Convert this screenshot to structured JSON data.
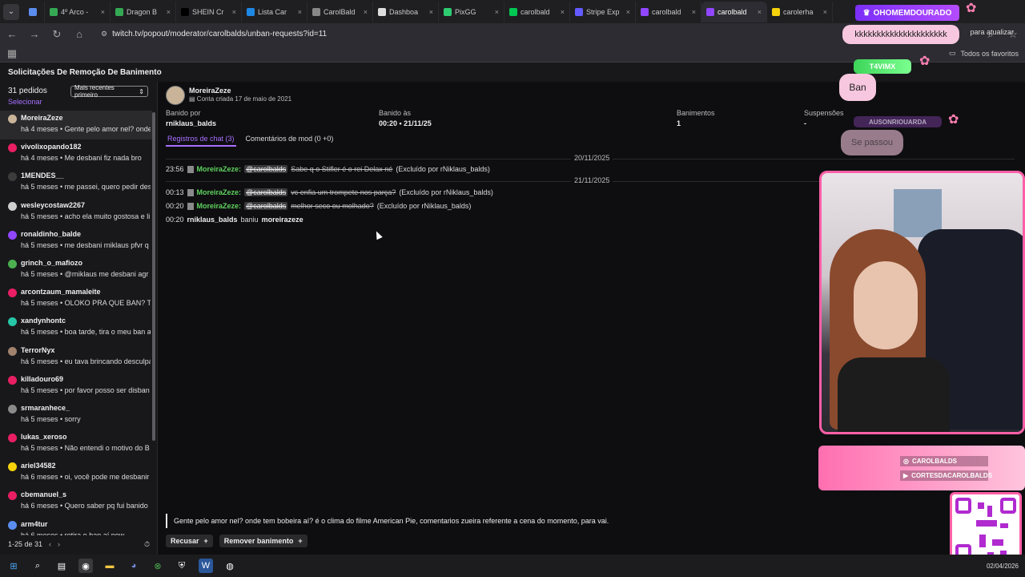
{
  "browser": {
    "tabs": [
      {
        "label": "",
        "color": "#5a8dee"
      },
      {
        "label": "4º Arco -",
        "color": "#34a853"
      },
      {
        "label": "Dragon B",
        "color": "#34a853"
      },
      {
        "label": "SHEIN Cr",
        "color": "#000000"
      },
      {
        "label": "Lista Car",
        "color": "#1e88e5"
      },
      {
        "label": "CarolBald",
        "color": "#888888"
      },
      {
        "label": "Dashboa",
        "color": "#dddddd"
      },
      {
        "label": "PixGG",
        "color": "#2ecc71"
      },
      {
        "label": "carolbald",
        "color": "#00c853"
      },
      {
        "label": "Stripe Exp",
        "color": "#635bff"
      },
      {
        "label": "carolbald",
        "color": "#9146ff"
      },
      {
        "label": "carolbald",
        "color": "#9146ff",
        "active": true
      },
      {
        "label": "carolerha",
        "color": "#f5d20a"
      }
    ],
    "url": "twitch.tv/popout/moderator/carolbalds/unban-requests?id=11",
    "update_label": "para atualizar",
    "favorites_label": "Todos os favoritos"
  },
  "app": {
    "header_title": "Solicitações De Remoção De Banimento"
  },
  "sidebar": {
    "count": "31 pedidos",
    "select": "Selecionar",
    "sort": "Mais recentes primeiro",
    "pagination": "1-25 de 31",
    "items": [
      {
        "name": "MoreiraZeze",
        "msg": "há 4 meses • Gente pelo amor nel? onde",
        "color": "#c9b49a",
        "selected": true
      },
      {
        "name": "vivolixopando182",
        "msg": "há 4 meses • Me desbani fiz nada bro",
        "color": "#e91e63"
      },
      {
        "name": "1MENDES__",
        "msg": "há 5 meses • me passei, quero pedir des",
        "color": "#3c3c3c"
      },
      {
        "name": "wesleycostaw2267",
        "msg": "há 5 meses • acho ela muito gostosa e li",
        "color": "#cfcfcf"
      },
      {
        "name": "ronaldinho_balde",
        "msg": "há 5 meses • me desbani rniklaus pfvr q",
        "color": "#9146ff"
      },
      {
        "name": "grinch_o_mafiozo",
        "msg": "há 5 meses • @rniklaus me desbani agr t",
        "color": "#4caf50"
      },
      {
        "name": "arcontzaum_mamaleite",
        "msg": "há 5 meses • OLOKO PRA QUE BAN? TAV",
        "color": "#e91e63"
      },
      {
        "name": "xandynhontc",
        "msg": "há 5 meses • boa tarde, tira o meu ban a",
        "color": "#26c6a6"
      },
      {
        "name": "TerrorNyx",
        "msg": "há 5 meses • eu tava brincando desculpa",
        "color": "#a0826d"
      },
      {
        "name": "killadouro69",
        "msg": "há 5 meses • por favor posso ser disban",
        "color": "#e91e63"
      },
      {
        "name": "srmaranhece_",
        "msg": "há 5 meses • sorry",
        "color": "#8a8a8a"
      },
      {
        "name": "lukas_xeroso",
        "msg": "há 5 meses • Não entendi o motivo do B",
        "color": "#e91e63"
      },
      {
        "name": "ariel34582",
        "msg": "há 6 meses • oi, você pode me desbanir",
        "color": "#f5d20a"
      },
      {
        "name": "cbemanuel_s",
        "msg": "há 6 meses • Quero saber pq fui banido",
        "color": "#e91e63"
      },
      {
        "name": "arm4tur",
        "msg": "há 6 meses • retira o ban aí pow",
        "color": "#5a8dee"
      }
    ]
  },
  "detail": {
    "username": "MoreiraZeze",
    "created": "Conta criada 17 de maio de 2021",
    "banned_by_label": "Banido por",
    "banned_by": "rniklaus_balds",
    "banned_at_label": "Banido às",
    "banned_at": "00:20 • 21/11/25",
    "bans_label": "Banimentos",
    "bans": "1",
    "suspensions_label": "Suspensões",
    "suspensions": "-",
    "tab_chat": "Registros de chat (3)",
    "tab_comments": "Comentários de mod (0 +0)",
    "date1": "20/11/2025",
    "date2": "21/11/2025",
    "logs": [
      {
        "time": "23:56",
        "user": "MoreiraZeze:",
        "mention": "@carolbalds",
        "text": "Sabe q o Stifler é o rei Delax né",
        "note": "(Excluído por rNiklaus_balds)"
      },
      {
        "time": "00:13",
        "user": "MoreiraZeze:",
        "mention": "@carolbalds",
        "text": "vc enfia um trompete nos parça?",
        "note": "(Excluído por rNiklaus_balds)"
      },
      {
        "time": "00:20",
        "user": "MoreiraZeze:",
        "mention": "@carolbalds",
        "text": "melhor seco ou molhado?",
        "note": "(Excluído por rNiklaus_balds)"
      }
    ],
    "ban_event": {
      "time": "00:20",
      "actor": "rniklaus_balds",
      "verb": "baniu",
      "target": "moreirazeze"
    },
    "request_text": "Gente pelo amor nel? onde tem bobeira aí? é o clima do filme American Pie, comentarios zueira referente a cena do momento, para vai.",
    "reject_label": "Recusar",
    "unban_label": "Remover banimento"
  },
  "overlay": {
    "badge": "OHOMEMDOURADO",
    "bubble": "kkkkkkkkkkkkkkkkkkkkk",
    "green": "T4VIMX",
    "ban": "Ban",
    "sub": "AUSONRIOUARDA",
    "sepassou": "Se passou",
    "social1": "CAROLBALDS",
    "social2": "CORTESDACAROLBALDS"
  },
  "taskbar": {
    "date": "02/04/2026"
  }
}
